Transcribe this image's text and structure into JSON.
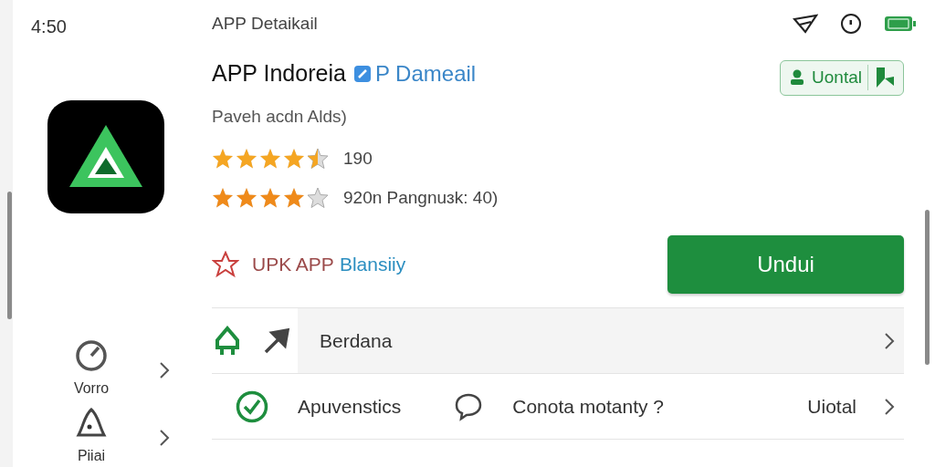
{
  "status_bar": {
    "time": "4:50"
  },
  "header": {
    "title": "APP Detaikail"
  },
  "app": {
    "name": "APP Indoreia",
    "tag": "P Dameail",
    "subtitle": "Paveh acdn Alds)"
  },
  "follow_button": {
    "label": "Uontal"
  },
  "ratings": [
    {
      "stars": 4.5,
      "text": "190"
    },
    {
      "stars": 4,
      "text": "920n Pangnuɜk: 40)"
    }
  ],
  "badge": {
    "part_1": "UPK APP",
    "part_2": "Blansiiy"
  },
  "download_button": {
    "label": "Undui"
  },
  "sidebar": {
    "items": [
      {
        "kind": "gauge",
        "label": "Vorro"
      },
      {
        "kind": "bell",
        "label": "Piiai"
      }
    ]
  },
  "rows": [
    {
      "kind": "home",
      "items": [
        {
          "kind": "arrow",
          "label": "Berdana"
        }
      ],
      "value": ""
    },
    {
      "kind": "check",
      "items": [
        {
          "kind": "check",
          "label": "Apuvenstics"
        },
        {
          "kind": "chat",
          "label": "Conota motanty ?"
        }
      ],
      "value": "Uiotal"
    }
  ]
}
